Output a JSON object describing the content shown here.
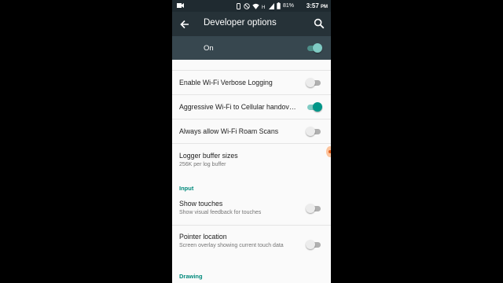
{
  "status_bar": {
    "battery": "81%",
    "time": "3:57",
    "time_suffix": "PM"
  },
  "toolbar": {
    "title": "Developer options",
    "back_icon": "arrow-back-icon",
    "search_icon": "search-icon"
  },
  "master_switch": {
    "label": "On",
    "checked": true
  },
  "settings": [
    {
      "title": "Enable Wi-Fi Verbose Logging",
      "checked": false
    },
    {
      "title": "Aggressive Wi-Fi to Cellular handov…",
      "checked": true
    },
    {
      "title": "Always allow Wi-Fi Roam Scans",
      "checked": false
    },
    {
      "title": "Logger buffer sizes",
      "summary": "256K per log buffer"
    },
    {
      "category": "Input"
    },
    {
      "title": "Show touches",
      "summary": "Show visual feedback for touches",
      "checked": false
    },
    {
      "title": "Pointer location",
      "summary": "Screen overlay showing current touch data",
      "checked": false
    },
    {
      "category": "Drawing"
    }
  ],
  "colors": {
    "status_bar": "#1f2a30",
    "toolbar": "#263238",
    "master_row": "#37474f",
    "accent": "#009688",
    "category_text": "#00897b"
  }
}
